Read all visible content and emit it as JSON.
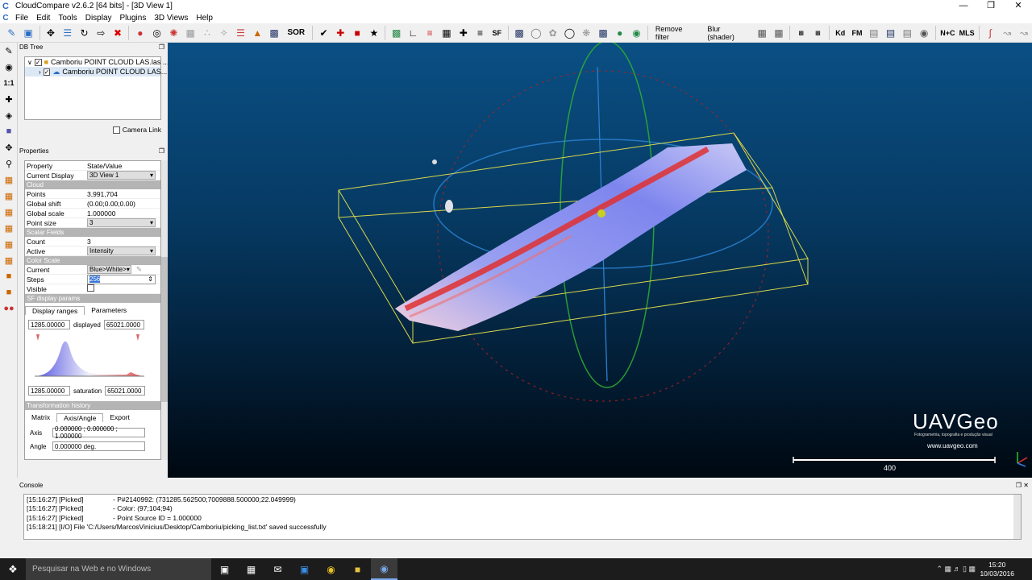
{
  "window": {
    "title": "CloudCompare v2.6.2 [64 bits] - [3D View 1]",
    "app_icon": "C"
  },
  "menu": [
    "File",
    "Edit",
    "Tools",
    "Display",
    "Plugins",
    "3D Views",
    "Help"
  ],
  "toolbar": {
    "remove_filter": "Remove filter",
    "blur_shader": "Blur (shader)",
    "sor": "SOR",
    "kd": "Kd",
    "fm": "FM",
    "nc": "N+C",
    "mls": "MLS"
  },
  "dbtree": {
    "title": "DB Tree",
    "root": "Camboriu POINT CLOUD LAS.las ...",
    "child": "Camboriu POINT CLOUD LAS...",
    "camera_link": "Camera Link"
  },
  "properties": {
    "title": "Properties",
    "header_property": "Property",
    "header_value": "State/Value",
    "current_display_label": "Current Display",
    "current_display": "3D View 1",
    "cloud_section": "Cloud",
    "points_label": "Points",
    "points": "3,991,704",
    "global_shift_label": "Global shift",
    "global_shift": "(0.00;0.00;0.00)",
    "global_scale_label": "Global scale",
    "global_scale": "1.000000",
    "point_size_label": "Point size",
    "point_size": "3",
    "sf_section": "Scalar Fields",
    "count_label": "Count",
    "count": "3",
    "active_label": "Active",
    "active": "Intensity",
    "color_scale_section": "Color Scale",
    "current_label": "Current",
    "current": "Blue>White>",
    "steps_label": "Steps",
    "steps": "256",
    "visible_label": "Visible",
    "sf_display_section": "SF display params",
    "tab_display_ranges": "Display ranges",
    "tab_parameters": "Parameters",
    "range_min": "1285.00000",
    "displayed_label": "displayed",
    "range_max": "65021.0000",
    "sat_min": "1285.00000",
    "saturation_label": "saturation",
    "sat_max": "65021.0000",
    "transform_section": "Transformation history",
    "tab_matrix": "Matrix",
    "tab_axis_angle": "Axis/Angle",
    "tab_export": "Export",
    "axis_label": "Axis",
    "axis": "0.000000 ; 0.000000 ; 1.000000",
    "angle_label": "Angle",
    "angle": "0.000000 deg."
  },
  "view": {
    "scale_value": "400",
    "logo": "UAVGeo",
    "logo_tagline": "Fotogrametria, topografia e produção visual",
    "logo_url": "www.uavgeo.com"
  },
  "console": {
    "title": "Console",
    "rows": [
      {
        "time": "[15:16:27] [Picked]",
        "msg": "- P#2140992: (731285.562500;7009888.500000;22.049999)"
      },
      {
        "time": "[15:16:27] [Picked]",
        "msg": "- Color: (97;104;94)"
      },
      {
        "time": "[15:16:27] [Picked]",
        "msg": "- Point Source ID = 1.000000"
      },
      {
        "time": "[15:18:21] [I/O] File 'C:/Users/MarcosVinicius/Desktop/Camboriu/picking_list.txt' saved successfully",
        "msg": ""
      }
    ]
  },
  "taskbar": {
    "search": "Pesquisar na Web e no Windows",
    "time": "15:20",
    "date": "10/03/2016"
  },
  "colors": {
    "view_top": "#0a4f84",
    "view_bottom": "#000810",
    "bbox": "#d8d84a",
    "sect": "#b4b4b4"
  }
}
